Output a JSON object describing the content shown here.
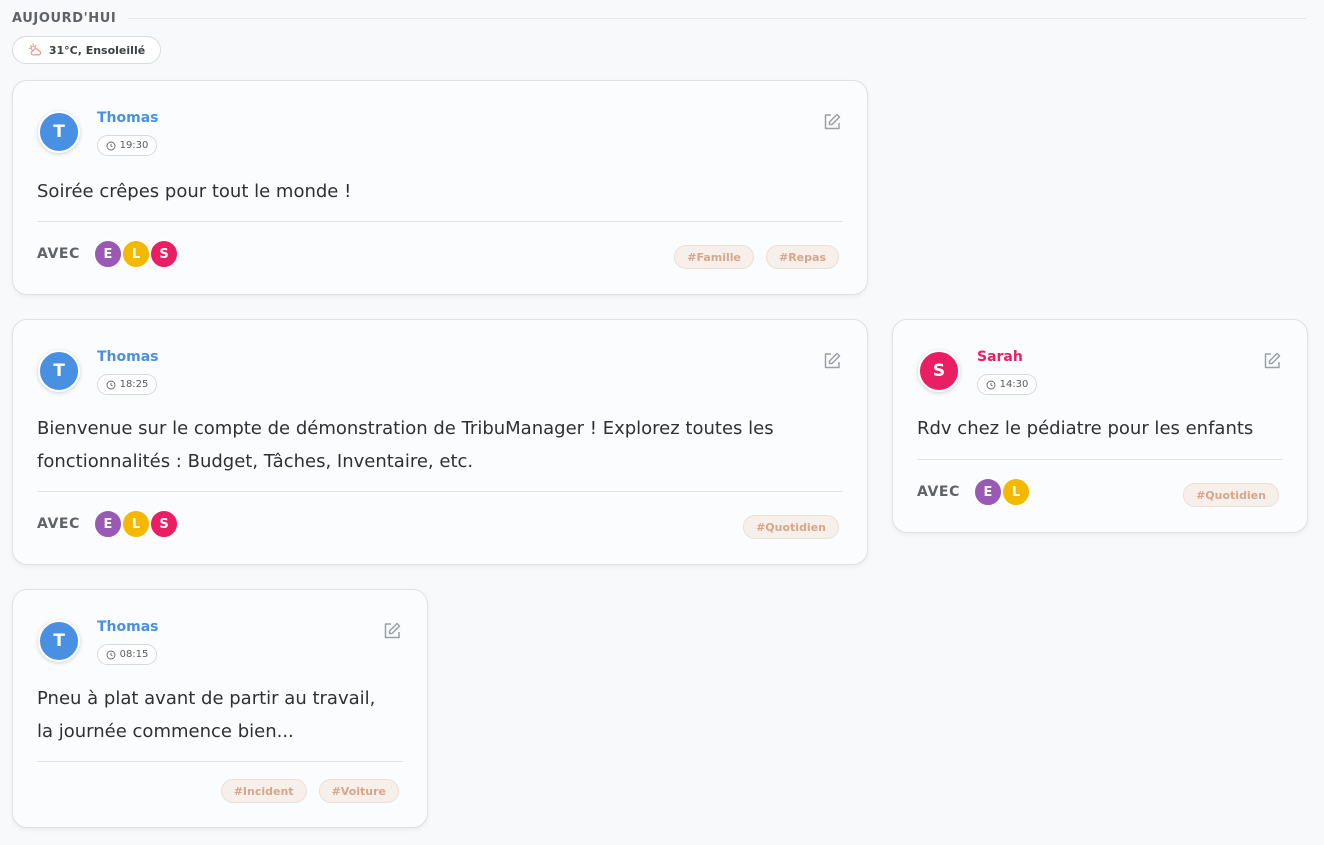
{
  "day": {
    "title": "AUJOURD'HUI"
  },
  "weather": {
    "label": "31°C, Ensoleillé",
    "icon": "partly-cloudy-icon"
  },
  "colors": {
    "thomas": "#4a90e2",
    "sarah": "#e91e63",
    "member_e": "#9b59b6",
    "member_l": "#f5b800",
    "member_s": "#e91e63"
  },
  "with_label": "AVEC",
  "posts": [
    {
      "author": "Thomas",
      "initial": "T",
      "time": "19:30",
      "message": "Soirée crêpes pour tout le monde !",
      "with": [
        "E",
        "L",
        "S"
      ],
      "tags": [
        "#Famille",
        "#Repas"
      ]
    },
    {
      "author": "Thomas",
      "initial": "T",
      "time": "18:25",
      "message": "Bienvenue sur le compte de démonstration de TribuManager ! Explorez toutes les fonctionnalités : Budget, Tâches, Inventaire, etc.",
      "with": [
        "E",
        "L",
        "S"
      ],
      "tags": [
        "#Quotidien"
      ]
    },
    {
      "author": "Sarah",
      "initial": "S",
      "time": "14:30",
      "message": "Rdv chez le pédiatre pour les enfants",
      "with": [
        "E",
        "L"
      ],
      "tags": [
        "#Quotidien"
      ]
    },
    {
      "author": "Thomas",
      "initial": "T",
      "time": "08:15",
      "message": "Pneu à plat avant de partir au travail, la journée commence bien...",
      "with": [],
      "tags": [
        "#Incident",
        "#Voiture"
      ]
    }
  ]
}
